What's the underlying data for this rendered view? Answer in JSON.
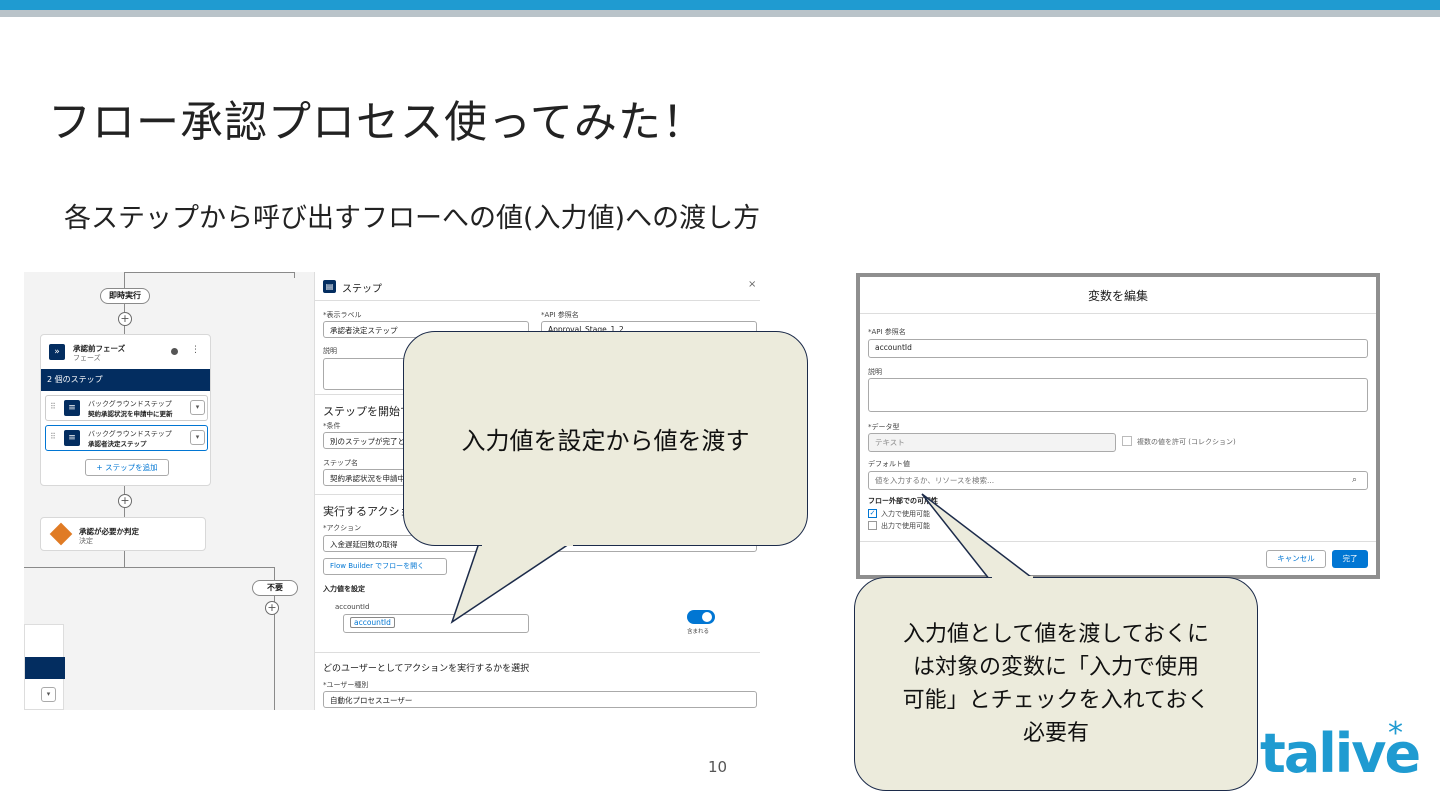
{
  "slide": {
    "title": "フロー承認プロセス使ってみた！",
    "subtitle": "各ステップから呼び出すフローへの値(入力値)への渡し方",
    "page_number": "10",
    "logo_text": "talive"
  },
  "flow": {
    "immediate_label": "即時実行",
    "phase_title": "承認前フェーズ",
    "phase_type": "フェーズ",
    "steps_header": "2 個のステップ",
    "step1_type": "バックグラウンドステップ",
    "step1_name": "契約承認状況を申請中に更新",
    "step2_type": "バックグラウンドステップ",
    "step2_name": "承認者決定ステップ",
    "add_step": "+ ステップを追加",
    "decision_title": "承認が必要か判定",
    "decision_type": "決定",
    "unnecessary_label": "不要"
  },
  "step_panel": {
    "header": "ステップ",
    "display_label_lbl": "*表示ラベル",
    "display_label_val": "承認者決定ステップ",
    "api_name_lbl": "*API 参照名",
    "api_name_val": "Approval_Stage_1_2",
    "description_lbl": "説明",
    "start_section": "ステップを開始する",
    "condition_lbl": "*条件",
    "condition_val": "別のステップが完了と",
    "step_name_lbl": "ステップ名",
    "step_name_val": "契約承認状況を申請中",
    "action_section": "実行するアクション",
    "action_lbl": "*アクション",
    "action_val": "入金遅延回数の取得",
    "open_flow_builder": "Flow Builder でフローを開く",
    "input_values": "入力値を設定",
    "account_id_lbl": "accountId",
    "account_id_chip": "accountId",
    "included": "含まれる",
    "user_section": "どのユーザーとしてアクションを実行するかを選択",
    "user_type_lbl": "*ユーザー種別",
    "user_type_val": "自動化プロセスユーザー"
  },
  "dialog": {
    "title": "変数を編集",
    "api_name_lbl": "*API 参照名",
    "api_name_val": "accountId",
    "description_lbl": "説明",
    "data_type_lbl": "*データ型",
    "data_type_val": "テキスト",
    "allow_multiple": "複数の値を許可 (コレクション)",
    "default_value_lbl": "デフォルト値",
    "default_value_placeholder": "値を入力するか、リソースを検索...",
    "availability_header": "フロー外部での可用性",
    "available_input": "入力で使用可能",
    "available_output": "出力で使用可能",
    "cancel": "キャンセル",
    "done": "完了"
  },
  "callouts": {
    "callout1": "入力値を設定から値を渡す",
    "callout2_line1": "入力値として値を渡しておくに",
    "callout2_line2": "は対象の変数に「入力で使用",
    "callout2_line3": "可能」とチェックを入れておく",
    "callout2_line4": "必要有"
  },
  "colors": {
    "accent": "#1f9bd1",
    "sf_blue": "#0176d3",
    "sf_navy": "#032d60",
    "callout_fill": "#ecebdc"
  }
}
